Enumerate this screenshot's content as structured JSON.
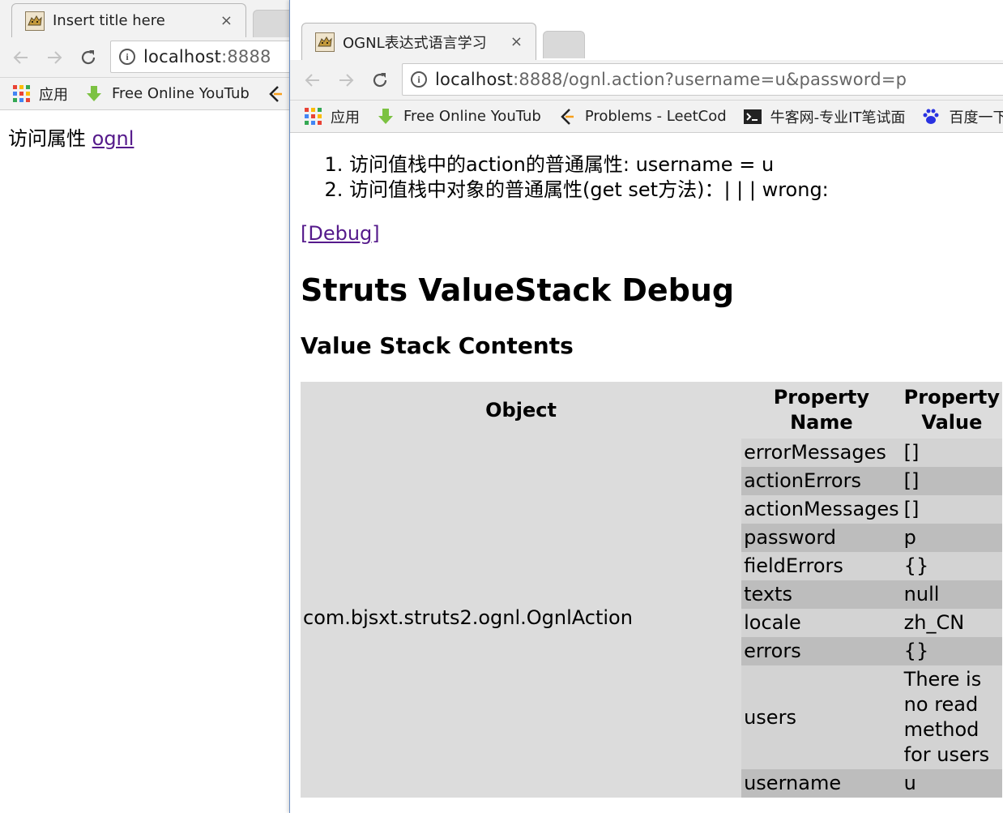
{
  "win1": {
    "tab_title": "Insert title here",
    "tab_close": "×",
    "url_host": "localhost",
    "url_rest": ":8888",
    "bookmarks": [
      "应用",
      "Free Online YouTub"
    ],
    "page_text": "访问属性",
    "page_link": "ognl"
  },
  "win2": {
    "tab_title": "OGNL表达式语言学习",
    "tab_close": "×",
    "url_host": "localhost",
    "url_rest": ":8888/ognl.action?username=u&password=p",
    "bookmarks": [
      "应用",
      "Free Online YouTub",
      "Problems - LeetCod",
      "牛客网-专业IT笔试面",
      "百度一下"
    ],
    "list": [
      "访问值栈中的action的普通属性: username = u",
      "访问值栈中对象的普通属性(get set方法)：| | | wrong:"
    ],
    "debug_link": "[Debug]",
    "h1": "Struts ValueStack Debug",
    "h2": "Value Stack Contents",
    "table": {
      "headers": [
        "Object",
        "Property Name",
        "Property Value"
      ],
      "object": "com.bjsxt.struts2.ognl.OgnlAction",
      "rows": [
        {
          "name": "errorMessages",
          "value": "[]"
        },
        {
          "name": "actionErrors",
          "value": "[]"
        },
        {
          "name": "actionMessages",
          "value": "[]"
        },
        {
          "name": "password",
          "value": "p"
        },
        {
          "name": "fieldErrors",
          "value": "{}"
        },
        {
          "name": "texts",
          "value": "null"
        },
        {
          "name": "locale",
          "value": "zh_CN"
        },
        {
          "name": "errors",
          "value": "{}"
        },
        {
          "name": "users",
          "value": "There is no read method for users"
        },
        {
          "name": "username",
          "value": "u"
        }
      ]
    }
  },
  "colors": {
    "link_visited": "#551a8b",
    "link": "#0000ee",
    "row_light": "#d3d3d3",
    "row_dark": "#bdbdbd",
    "table_bg": "#dcdcdc"
  }
}
